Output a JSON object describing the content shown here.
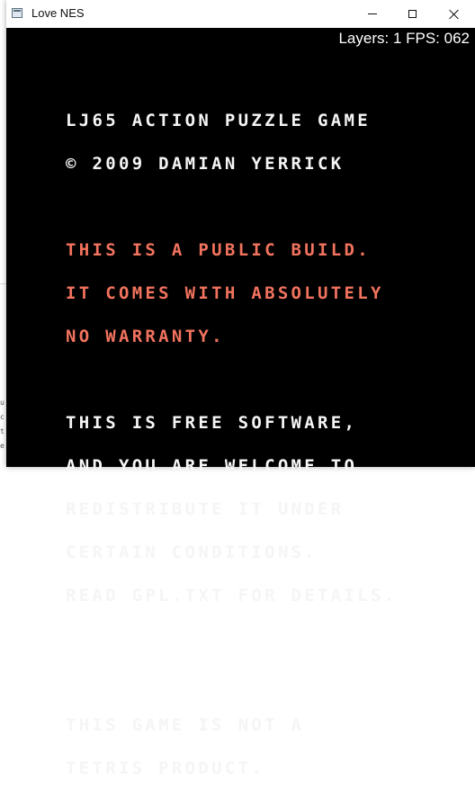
{
  "window": {
    "title": "Love NES",
    "icons": {
      "app": "app-window-icon",
      "minimize": "minimize-icon",
      "maximize": "maximize-icon",
      "close": "close-icon"
    }
  },
  "hud": {
    "text": "Layers: 1 FPS: 062"
  },
  "screen": {
    "title_lines": [
      "LJ65 ACTION PUZZLE GAME",
      "© 2009 DAMIAN YERRICK"
    ],
    "warning_lines": [
      "THIS IS A PUBLIC BUILD.",
      "IT COMES WITH ABSOLUTELY",
      "NO WARRANTY."
    ],
    "license_lines": [
      "THIS IS FREE SOFTWARE,",
      "AND YOU ARE WELCOME TO",
      "REDISTRIBUTE IT UNDER",
      "CERTAIN CONDITIONS.",
      "READ GPL.TXT FOR DETAILS."
    ],
    "disclaimer_lines": [
      "THIS GAME IS NOT A",
      "TETRIS PRODUCT."
    ],
    "colors": {
      "text": "#f5f5f5",
      "warning": "#f2735e",
      "background": "#000000"
    }
  }
}
